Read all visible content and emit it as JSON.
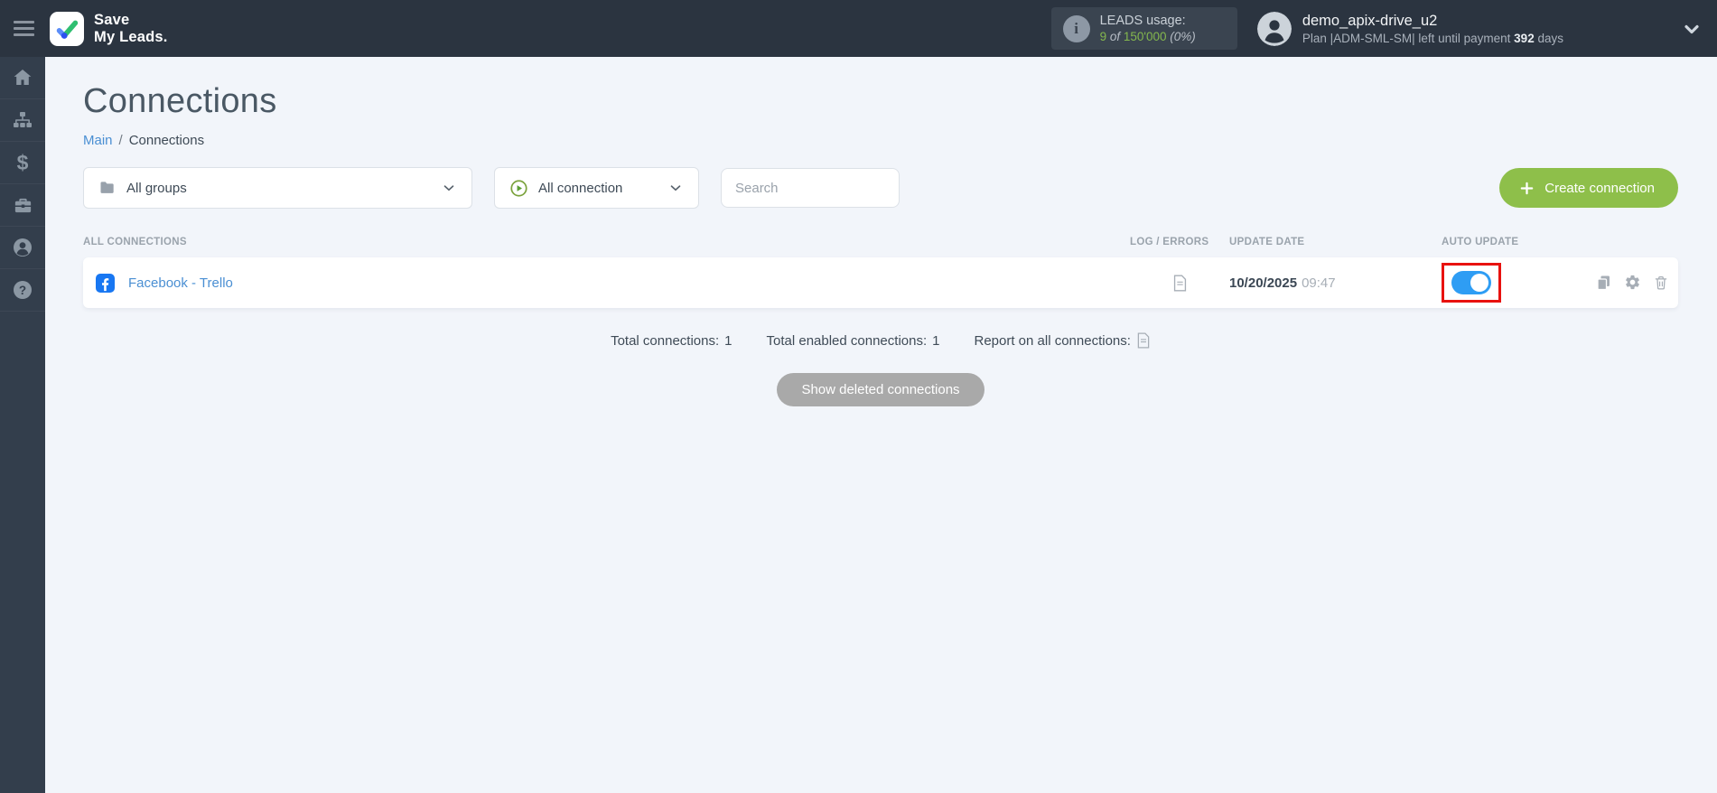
{
  "header": {
    "logo_line1": "Save",
    "logo_line2": "My Leads.",
    "leads_usage": {
      "label": "LEADS usage:",
      "used": "9",
      "of_word": "of",
      "total": "150'000",
      "percent": "(0%)"
    },
    "user": {
      "name": "demo_apix-drive_u2",
      "plan_prefix": "Plan |ADM-SML-SM| left until payment",
      "days_value": "392",
      "days_suffix": "days"
    }
  },
  "sidebar": {
    "items": [
      {
        "icon": "home-icon"
      },
      {
        "icon": "sitemap-icon"
      },
      {
        "icon": "dollar-icon",
        "glyph": "$"
      },
      {
        "icon": "briefcase-icon"
      },
      {
        "icon": "user-icon"
      },
      {
        "icon": "help-icon",
        "glyph": "?"
      }
    ],
    "info_glyph": "i"
  },
  "page": {
    "title": "Connections",
    "breadcrumb": {
      "main": "Main",
      "separator": "/",
      "current": "Connections"
    }
  },
  "filters": {
    "groups_dropdown": "All groups",
    "connection_dropdown": "All connection",
    "search_placeholder": "Search",
    "create_button": "Create connection"
  },
  "table": {
    "headers": {
      "all_connections": "ALL CONNECTIONS",
      "log_errors": "LOG / ERRORS",
      "update_date": "UPDATE DATE",
      "auto_update": "AUTO UPDATE"
    },
    "rows": [
      {
        "name": "Facebook - Trello",
        "date": "10/20/2025",
        "time": "09:47",
        "auto_update_on": true
      }
    ]
  },
  "summary": {
    "total_label": "Total connections:",
    "total_value": "1",
    "enabled_label": "Total enabled connections:",
    "enabled_value": "1",
    "report_label": "Report on all connections:"
  },
  "actions": {
    "show_deleted": "Show deleted connections"
  },
  "colors": {
    "header_bg": "#2b3440",
    "sidebar_bg": "#333e4c",
    "main_bg": "#f2f5fa",
    "accent_green": "#8ebf4a",
    "toggle_blue": "#2e9df4",
    "highlight_red": "#e8120f",
    "link_blue": "#4a8fd3",
    "facebook_blue": "#1877f2",
    "leads_green": "#84b74e"
  }
}
